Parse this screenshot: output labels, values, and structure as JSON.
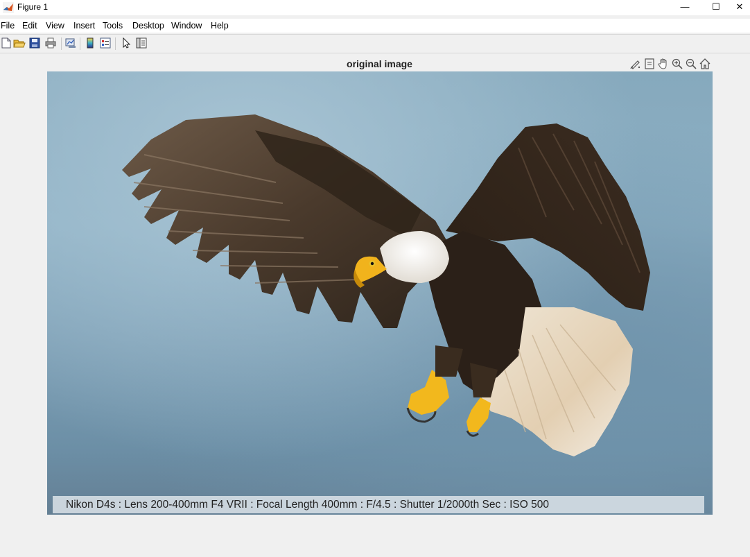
{
  "window": {
    "title": "Figure 1",
    "minimize_glyph": "—",
    "maximize_glyph": "☐",
    "close_glyph": "✕"
  },
  "menu": {
    "items": [
      "File",
      "Edit",
      "View",
      "Insert",
      "Tools",
      "Desktop",
      "Window",
      "Help"
    ]
  },
  "toolbar": {
    "icons": [
      "new-figure-icon",
      "open-file-icon",
      "save-icon",
      "print-icon",
      "link-plot-icon",
      "insert-colorbar-icon",
      "insert-legend-icon",
      "edit-plot-arrow-icon",
      "property-inspector-icon"
    ]
  },
  "axes": {
    "title": "original image",
    "tools": [
      "brush-icon",
      "data-tips-icon",
      "pan-hand-icon",
      "zoom-in-icon",
      "zoom-out-icon",
      "home-icon"
    ]
  },
  "photo": {
    "subject": "bald-eagle",
    "caption": "Nikon D4s : Lens 200-400mm F4 VRII : Focal Length 400mm : F/4.5 : Shutter 1/2000th Sec : ISO 500"
  }
}
